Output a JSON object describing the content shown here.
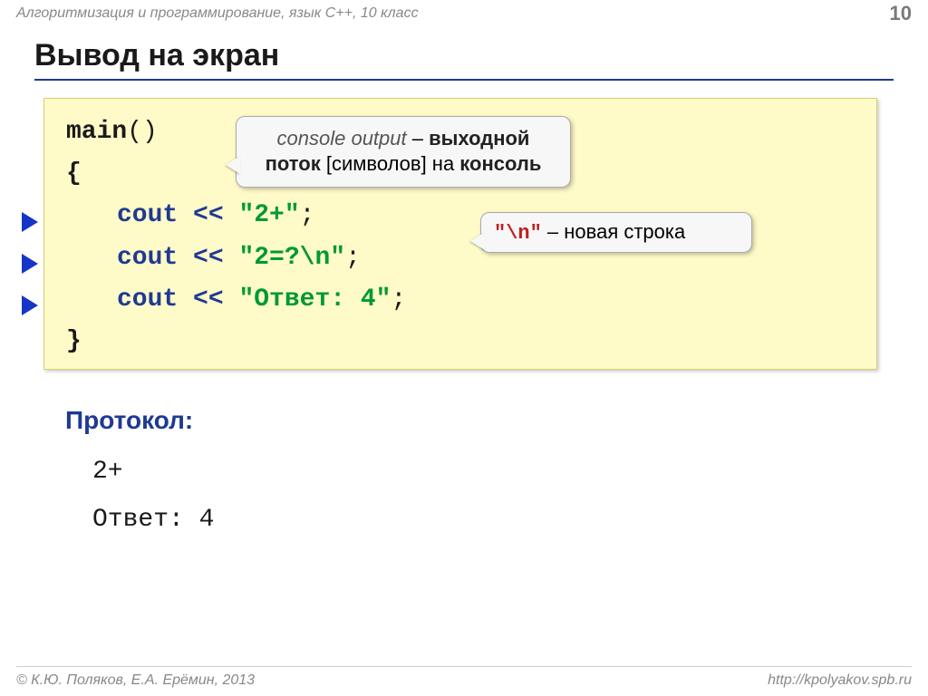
{
  "header": {
    "topic": "Алгоритмизация и программирование, язык  C++, 10 класс",
    "page": "10",
    "title": "Вывод на экран"
  },
  "code": {
    "line1_fn": "main",
    "line1_paren": "()",
    "line2_brace": "{",
    "kw": "cout",
    "op": " << ",
    "semi": ";",
    "str1": "\"2+\"",
    "str2": "\"2=?\\n\"",
    "str3": "\"Ответ: 4\"",
    "line6_brace": "}"
  },
  "callout1": {
    "italic": "console output",
    "dash": " – ",
    "bold1": "выходной поток",
    "plain1": " [символов] на ",
    "bold2": "консоль"
  },
  "callout2": {
    "mono": "\"\\n\"",
    "rest": " – новая строка"
  },
  "protocol": {
    "label": "Протокол:",
    "out1": "2+",
    "out2": "Ответ: 4"
  },
  "footer": {
    "left": "© К.Ю. Поляков, Е.А. Ерёмин, 2013",
    "right": "http://kpolyakov.spb.ru"
  }
}
